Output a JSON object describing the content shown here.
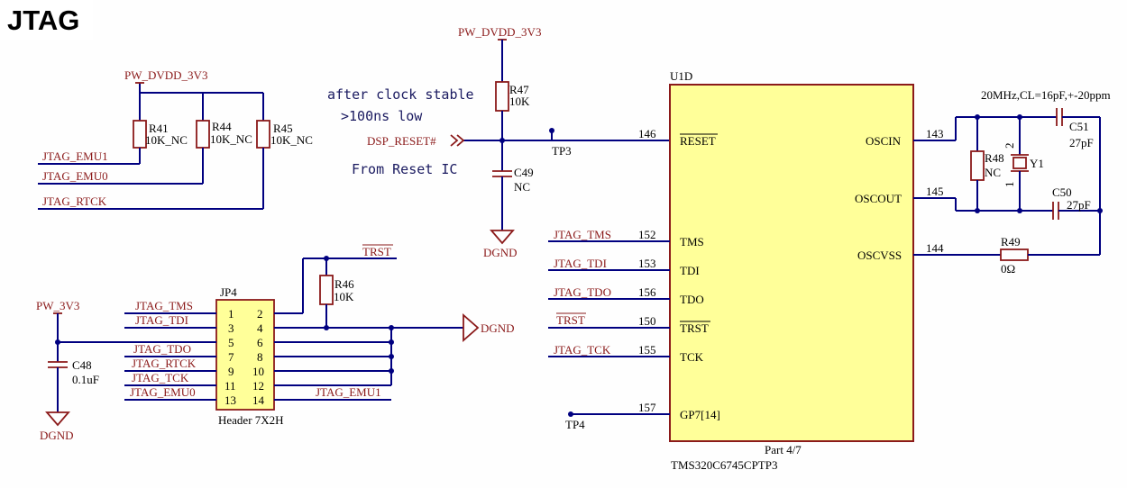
{
  "title": "JTAG",
  "nets": {
    "pw_dvdd": "PW_DVDD_3V3",
    "pw_3v3": "PW_3V3",
    "dgnd": "DGND",
    "dsp_reset": "DSP_RESET#",
    "jtag_emu1": "JTAG_EMU1",
    "jtag_emu0": "JTAG_EMU0",
    "jtag_rtck": "JTAG_RTCK",
    "jtag_tms": "JTAG_TMS",
    "jtag_tdi": "JTAG_TDI",
    "jtag_tdo": "JTAG_TDO",
    "jtag_tck": "JTAG_TCK",
    "trst": "TRST"
  },
  "notes": {
    "after_clock": "after clock stable",
    "gt100ns": ">100ns low",
    "from_reset": "From Reset IC",
    "crystal_spec": "20MHz,CL=16pF,+-20ppm"
  },
  "components": {
    "r41": {
      "ref": "R41",
      "value": "10K_NC"
    },
    "r44": {
      "ref": "R44",
      "value": "10K_NC"
    },
    "r45": {
      "ref": "R45",
      "value": "10K_NC"
    },
    "r46": {
      "ref": "R46",
      "value": "10K"
    },
    "r47": {
      "ref": "R47",
      "value": "10K"
    },
    "r48": {
      "ref": "R48",
      "value": "NC"
    },
    "r49": {
      "ref": "R49",
      "value": "0Ω"
    },
    "c48": {
      "ref": "C48",
      "value": "0.1uF"
    },
    "c49": {
      "ref": "C49",
      "value": "NC"
    },
    "c50": {
      "ref": "C50",
      "value": "27pF"
    },
    "c51": {
      "ref": "C51",
      "value": "27pF"
    },
    "y1": {
      "ref": "Y1",
      "pin1": "1",
      "pin2": "2"
    },
    "tp3": {
      "ref": "TP3"
    },
    "tp4": {
      "ref": "TP4"
    },
    "jp4": {
      "ref": "JP4",
      "value": "Header 7X2H",
      "pins": [
        "1",
        "2",
        "3",
        "4",
        "5",
        "6",
        "7",
        "8",
        "9",
        "10",
        "11",
        "12",
        "13",
        "14"
      ]
    },
    "u1d": {
      "ref": "U1D",
      "part": "Part 4/7",
      "value": "TMS320C6745CPTP3",
      "left_pins": [
        {
          "num": "146",
          "name": "RESET"
        },
        {
          "num": "152",
          "name": "TMS"
        },
        {
          "num": "153",
          "name": "TDI"
        },
        {
          "num": "156",
          "name": "TDO"
        },
        {
          "num": "150",
          "name": "TRST"
        },
        {
          "num": "155",
          "name": "TCK"
        },
        {
          "num": "157",
          "name": "GP7[14]"
        }
      ],
      "right_pins": [
        {
          "num": "143",
          "name": "OSCIN"
        },
        {
          "num": "145",
          "name": "OSCOUT"
        },
        {
          "num": "144",
          "name": "OSCVSS"
        }
      ]
    }
  }
}
